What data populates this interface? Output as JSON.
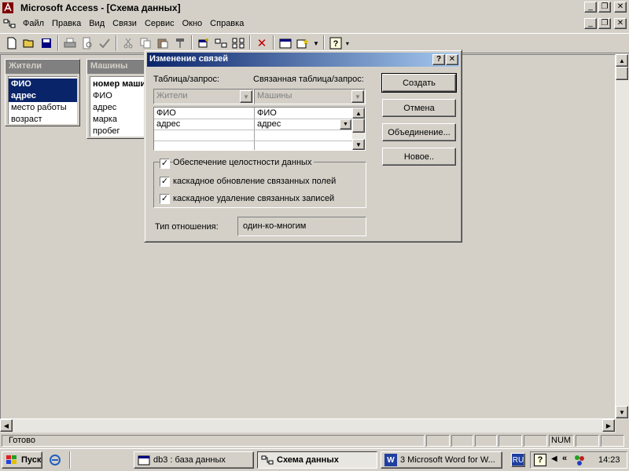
{
  "app": {
    "title": "Microsoft Access - [Схема данных]",
    "window_buttons": {
      "minimize": "_",
      "restore": "❐",
      "close": "✕"
    }
  },
  "menu": [
    "Файл",
    "Правка",
    "Вид",
    "Связи",
    "Сервис",
    "Окно",
    "Справка"
  ],
  "tables": [
    {
      "name": "Жители",
      "fields": [
        "ФИО",
        "адрес",
        "место работы",
        "возраст"
      ]
    },
    {
      "name": "Машины",
      "fields": [
        "номер машины",
        "ФИО",
        "адрес",
        "марка",
        "пробег"
      ]
    }
  ],
  "dialog": {
    "title": "Изменение связей",
    "help_btn": "?",
    "close_btn": "✕",
    "table_label": "Таблица/запрос:",
    "related_label": "Связанная таблица/запрос:",
    "table_value": "Жители",
    "related_value": "Машины",
    "rows": [
      {
        "left": "ФИО",
        "right": "ФИО"
      },
      {
        "left": "адрес",
        "right": "адрес"
      }
    ],
    "buttons": {
      "create": "Создать",
      "cancel": "Отмена",
      "join": "Объединение...",
      "new": "Новое.."
    },
    "checks": {
      "integrity": {
        "label": "Обеспечение целостности данных",
        "checked": true
      },
      "cascade_update": {
        "label": "каскадное обновление связанных полей",
        "checked": true
      },
      "cascade_delete": {
        "label": "каскадное удаление связанных записей",
        "checked": true
      }
    },
    "relation_type_label": "Тип отношения:",
    "relation_type_value": "один-ко-многим"
  },
  "status": {
    "text": "Готово",
    "num": "NUM"
  },
  "taskbar": {
    "start": "Пуск",
    "tasks": [
      {
        "label": "db3 : база данных",
        "active": false
      },
      {
        "label": "Схема данных",
        "active": true
      },
      {
        "label": "3 Microsoft Word for W...",
        "active": false
      }
    ],
    "lang": "RU",
    "clock": "14:23"
  },
  "colors": {
    "face": "#d4d0c8",
    "selection": "#0a246a",
    "title_gradient_end": "#a6caf0"
  }
}
